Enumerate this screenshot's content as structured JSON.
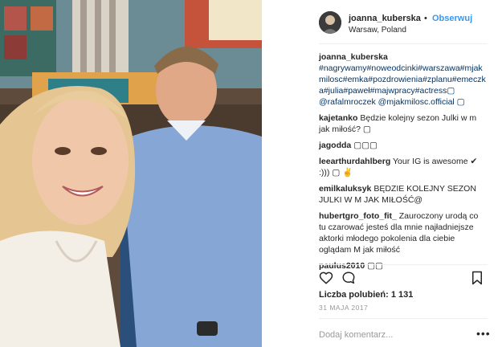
{
  "post": {
    "username": "joanna_kuberska",
    "separator": "•",
    "follow_label": "Obserwuj",
    "location": "Warsaw, Poland"
  },
  "comments": [
    {
      "author": "joanna_kuberska",
      "text": "#nagrywamy#noweodcinki#warszawa#mjakmilosc#emka#pozdrowienia#zplanu#emeczka#julia#paweł#majwpracy#actress▢ @rafalmroczek @mjakmilosc.official ▢"
    },
    {
      "author": "kajetanko",
      "text": "Będzie kolejny sezon Julki w m jak miłość? ▢"
    },
    {
      "author": "jagodda",
      "text": "▢▢▢"
    },
    {
      "author": "leearthurdahlberg",
      "text": "Your IG is awesome ✔ :))) ▢ ✌"
    },
    {
      "author": "emilkaluksyk",
      "text": "BĘDZIE KOLEJNY SEZON JULKI W M JAK MIŁOŚĆ@"
    },
    {
      "author": "hubertgro_foto_fit_",
      "text": "Zauroczony urodą co tu czarować jesteś dla mnie najładniejsze aktorki młodego pokolenia dla ciebie oglądam M jak miłość"
    },
    {
      "author": "paulus2010",
      "text": "▢▢"
    }
  ],
  "likes": "Liczba polubień: 1 131",
  "date": "31 MAJA 2017",
  "add_comment_placeholder": "Dodaj komentarz...",
  "more_label": "•••",
  "icons": {
    "like": "heart-icon",
    "comment": "comment-icon",
    "save": "bookmark-icon",
    "more": "more-options-icon"
  }
}
